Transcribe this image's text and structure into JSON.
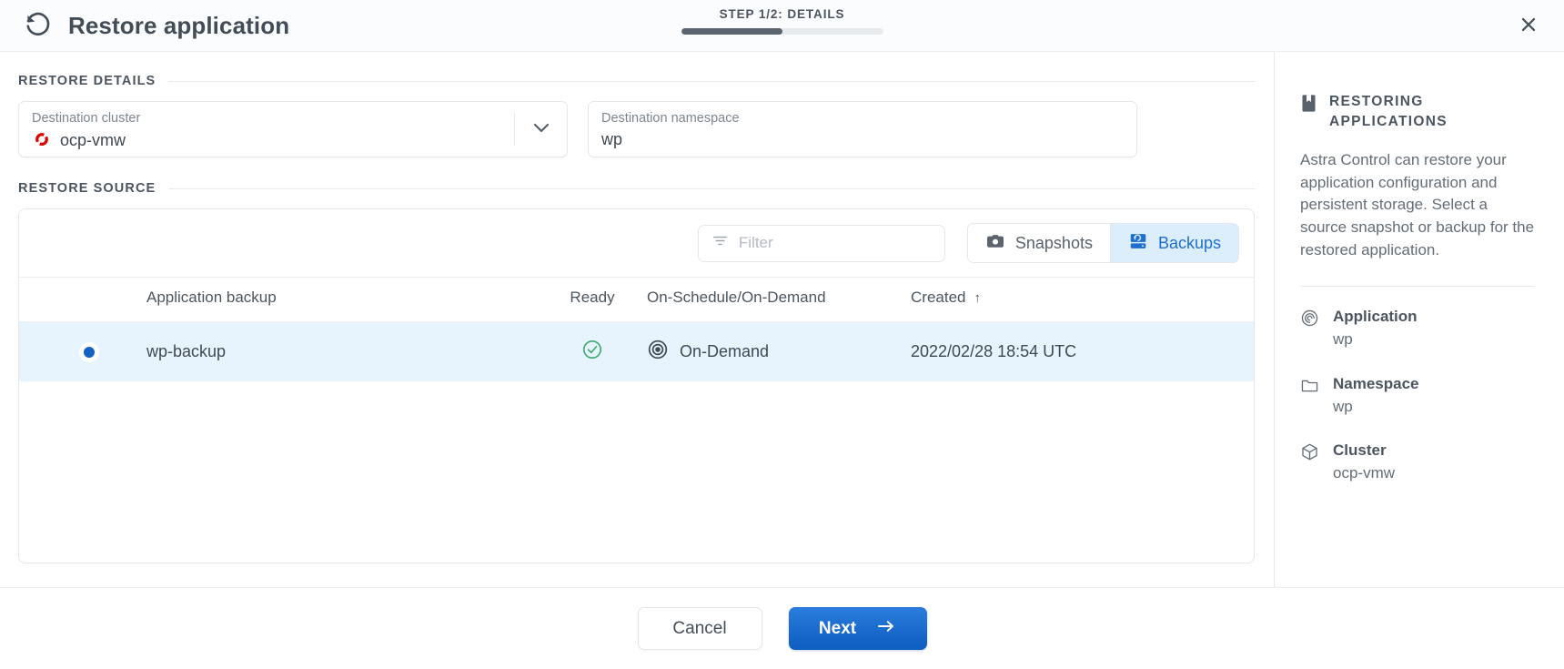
{
  "header": {
    "title": "Restore application",
    "restore_icon": "restore-rotate-left-icon",
    "step_label": "STEP 1/2: DETAILS",
    "step_progress_percent": 50,
    "close_icon": "close-icon"
  },
  "sections": {
    "restore_details_label": "RESTORE DETAILS",
    "restore_source_label": "RESTORE SOURCE"
  },
  "fields": {
    "destination_cluster": {
      "label": "Destination cluster",
      "value": "ocp-vmw",
      "icon": "openshift-logo-icon",
      "caret_icon": "chevron-down-icon"
    },
    "destination_namespace": {
      "label": "Destination namespace",
      "value": "wp",
      "placeholder": "Destination namespace"
    }
  },
  "toolbar": {
    "filter": {
      "value": "",
      "placeholder": "Filter",
      "icon": "filter-icon"
    },
    "tabs": [
      {
        "label": "Snapshots",
        "icon": "camera-icon",
        "active": false
      },
      {
        "label": "Backups",
        "icon": "backup-disk-icon",
        "active": true
      }
    ]
  },
  "table": {
    "columns": [
      {
        "key": "select",
        "label": ""
      },
      {
        "key": "name",
        "label": "Application backup"
      },
      {
        "key": "ready",
        "label": "Ready"
      },
      {
        "key": "schedule",
        "label": "On-Schedule/On-Demand"
      },
      {
        "key": "created",
        "label": "Created"
      }
    ],
    "sort": {
      "column": "Created",
      "direction_icon": "sort-arrow-up-icon",
      "glyph": "↑"
    },
    "rows": [
      {
        "selected": true,
        "name": "wp-backup",
        "ready_icon": "check-circle-icon",
        "schedule_icon": "target-bullseye-icon",
        "schedule": "On-Demand",
        "created": "2022/02/28 18:54 UTC"
      }
    ]
  },
  "sidebar": {
    "icon": "book-bookmark-icon",
    "title": "RESTORING APPLICATIONS",
    "description": "Astra Control can restore your application configuration and persistent storage. Select a source snapshot or backup for the restored application.",
    "items": [
      {
        "icon": "application-spiral-icon",
        "label": "Application",
        "value": "wp"
      },
      {
        "icon": "folder-icon",
        "label": "Namespace",
        "value": "wp"
      },
      {
        "icon": "cluster-cube-icon",
        "label": "Cluster",
        "value": "ocp-vmw"
      }
    ]
  },
  "footer": {
    "cancel_label": "Cancel",
    "next_label": "Next",
    "next_arrow_icon": "arrow-right-icon"
  },
  "colors": {
    "accent_blue": "#1e6fd0",
    "tab_active_bg": "#dcedfb",
    "row_selected_bg": "#e8f4fd",
    "ready_green": "#3aab6e",
    "openshift_red": "#e00000",
    "text_dark": "#434d57",
    "text_muted": "#7d868f"
  }
}
